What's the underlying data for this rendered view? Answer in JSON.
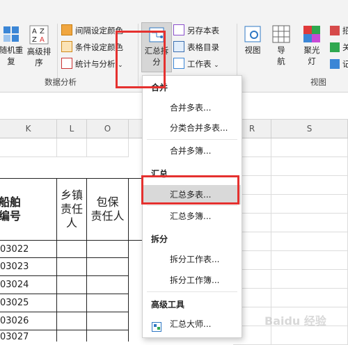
{
  "ribbon": {
    "btn_random": "随机重\n复",
    "btn_sort": "高级排\n序",
    "interval_color": "间隔设定颜色",
    "cond_color": "条件设定颜色",
    "stats": "统计与分析",
    "group_data_analysis": "数据分析",
    "btn_split": "汇总拆\n分",
    "save_sheet": "另存本表",
    "table_dir": "表格目录",
    "worksheet": "工作表",
    "btn_view": "视图",
    "btn_nav": "导\n航",
    "btn_spot": "聚光\n灯",
    "group_view": "视图",
    "right_1": "招",
    "right_2": "关",
    "right_3": "记"
  },
  "columns": [
    "K",
    "L",
    "O",
    "",
    "R",
    "S"
  ],
  "table": {
    "header_ship": "船舶\n编号",
    "header_town": "乡镇\n责任\n人",
    "header_bao": "包保\n责任人",
    "rows": [
      "03022",
      "03023",
      "03024",
      "03025",
      "03026",
      "03027"
    ]
  },
  "menu": {
    "section_merge": "合并",
    "merge_multi_sheets": "合并多表...",
    "category_merge": "分类合并多表...",
    "merge_multi_books": "合并多簿...",
    "section_summary": "汇总",
    "summary_multi_sheets": "汇总多表...",
    "summary_multi_books": "汇总多簿...",
    "section_split": "拆分",
    "split_sheet": "拆分工作表...",
    "split_book": "拆分工作簿...",
    "section_advanced": "高级工具",
    "summary_master": "汇总大师..."
  },
  "colors": {
    "accent_red": "#e5312f",
    "hover_gray": "#d9d9d9"
  },
  "watermark": "Baidu 经验"
}
